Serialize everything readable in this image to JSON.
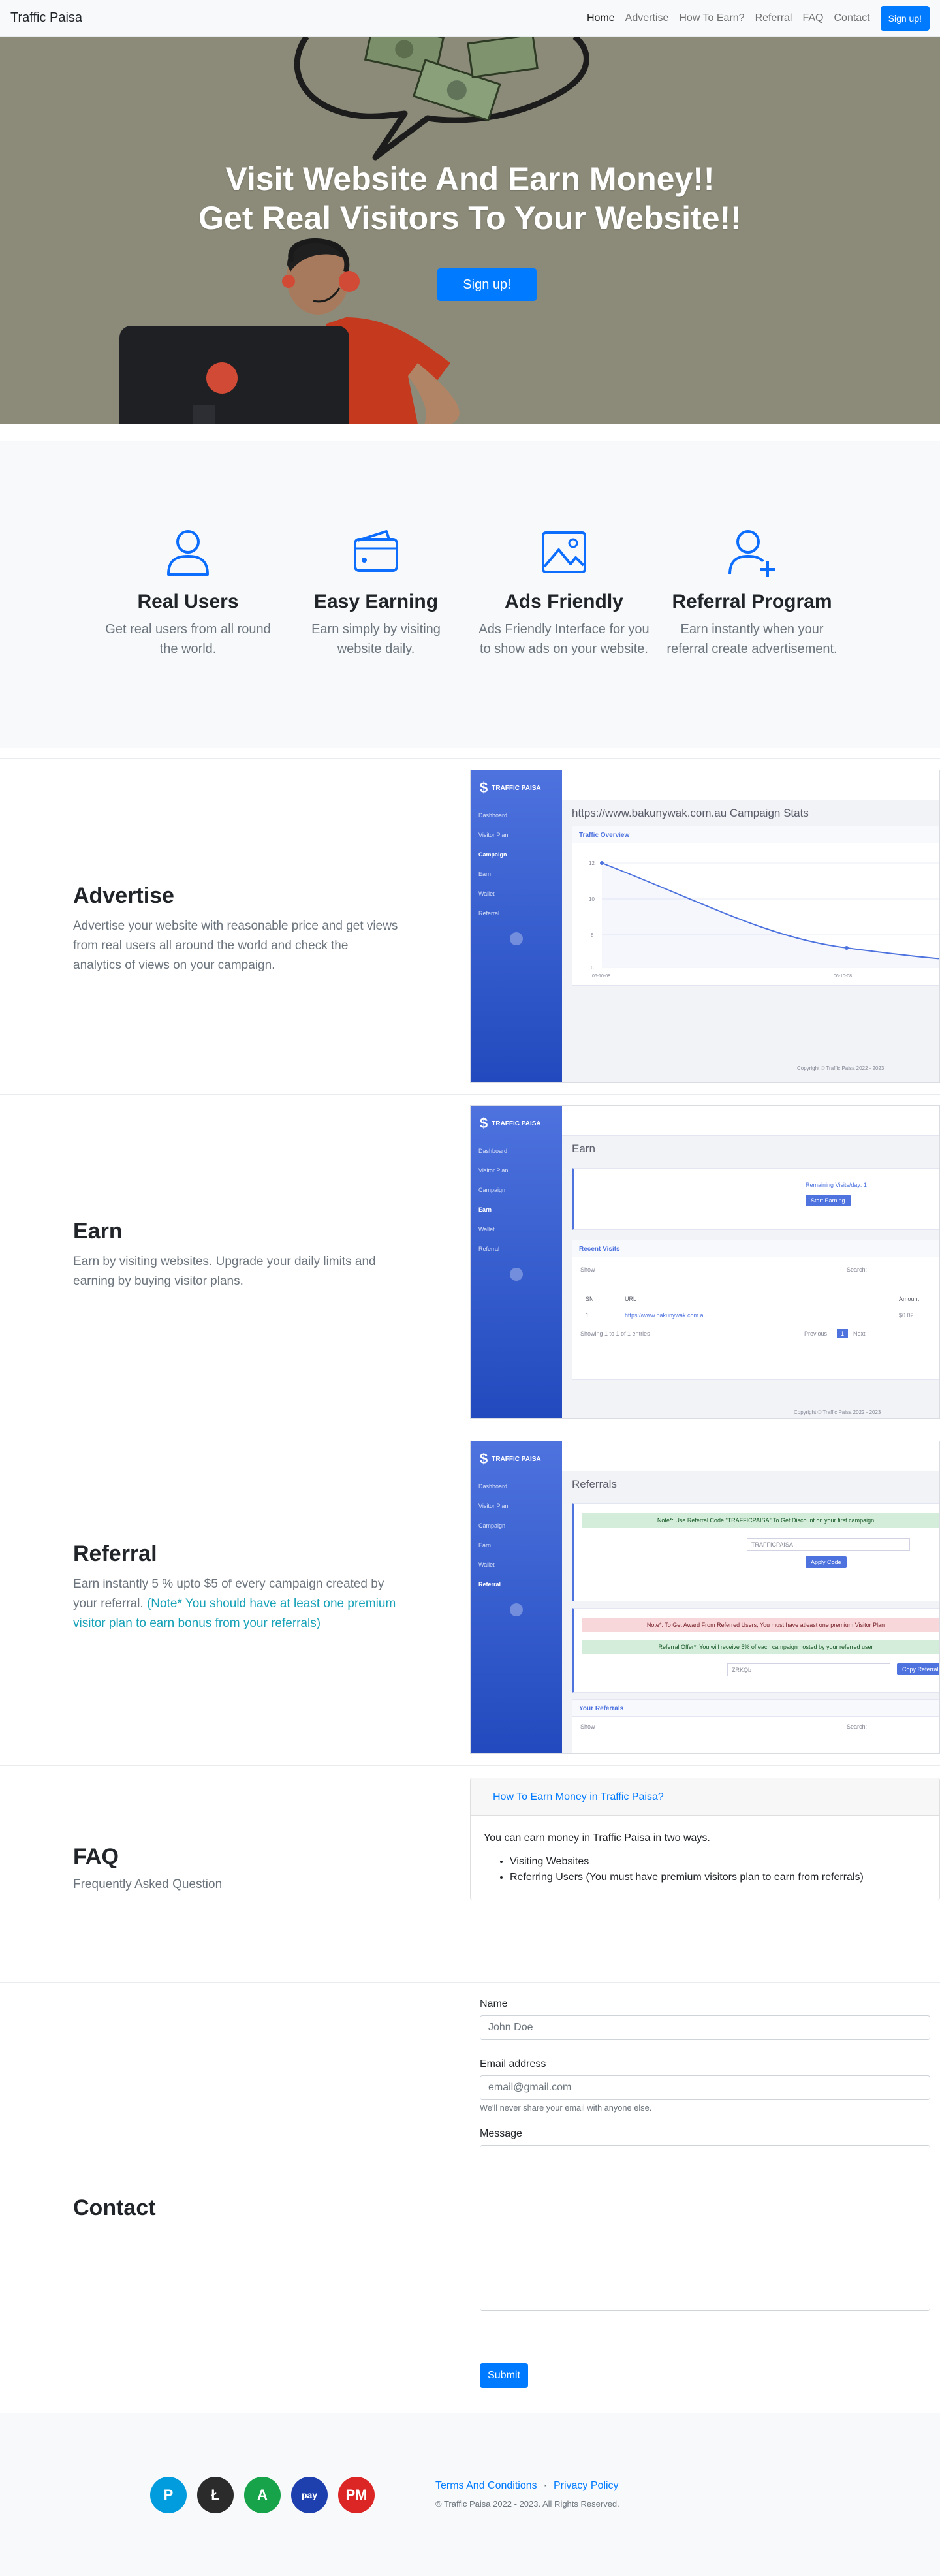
{
  "nav": {
    "brand": "Traffic Paisa",
    "links": [
      "Home",
      "Advertise",
      "How To Earn?",
      "Referral",
      "FAQ",
      "Contact"
    ],
    "signup": "Sign up!"
  },
  "hero": {
    "line1": "Visit Website And Earn Money!!",
    "line2": "Get Real Visitors To Your Website!!",
    "cta": "Sign up!"
  },
  "features": [
    {
      "icon": "user-icon",
      "title": "Real Users",
      "text": "Get real users from all round the world."
    },
    {
      "icon": "wallet-icon",
      "title": "Easy Earning",
      "text": "Earn simply by visiting website daily."
    },
    {
      "icon": "image-icon",
      "title": "Ads Friendly",
      "text": "Ads Friendly Interface for you to show ads on your website."
    },
    {
      "icon": "user-plus-icon",
      "title": "Referral Program",
      "text": "Earn instantly when your referral create advertisement."
    }
  ],
  "advertise": {
    "title": "Advertise",
    "text": "Advertise your website with reasonable price and get views from real users all around the world and check the analytics of views on your campaign.",
    "shot": {
      "logo": "TRAFFIC PAISA",
      "menu": [
        "Dashboard",
        "Visitor Plan",
        "Campaign",
        "Earn",
        "Wallet",
        "Referral"
      ],
      "heading": "https://www.bakunywak.com.au Campaign Stats",
      "card": "Traffic Overview",
      "yticks": [
        "12",
        "10",
        "8",
        "6"
      ],
      "xticks": [
        "06-10-08",
        "06-10-08"
      ],
      "footer": "Copyright © Traffic Paisa 2022 - 2023"
    }
  },
  "earn": {
    "title": "Earn",
    "text": "Earn by visiting websites. Upgrade your daily limits and earning by buying visitor plans.",
    "shot": {
      "heading": "Earn",
      "remaining": "Remaining Visits/day: 1",
      "start": "Start Earning",
      "recent": "Recent Visits",
      "show": "Show",
      "search": "Search:",
      "cols": [
        "SN",
        "URL",
        "Amount"
      ],
      "row": [
        "1",
        "https://www.bakunywak.com.au",
        "$0.02"
      ],
      "showing": "Showing 1 to 1 of 1 entries",
      "prev": "Previous",
      "page": "1",
      "next": "Next",
      "footer": "Copyright © Traffic Paisa 2022 - 2023"
    }
  },
  "referral": {
    "title": "Referral",
    "text": "Earn instantly 5 % upto $5 of every campaign created by your referral.",
    "note": "(Note* You should have at least one premium visitor plan to earn bonus from your referrals)",
    "shot": {
      "heading": "Referrals",
      "alert1": "Note*: Use Referral Code \"TRAFFICPAISA\" To Get Discount on your first campaign",
      "code": "TRAFFICPAISA",
      "apply": "Apply Code",
      "alert2": "Note*: To Get Award From Referred Users, You must have atleast one premium Visitor Plan",
      "alert3": "Referral Offer*: You will receive 5% of each campaign hosted by your referred user",
      "ref": "ZRKQb",
      "copy": "Copy Referral Link",
      "your": "Your Referrals",
      "show": "Show",
      "search": "Search:"
    }
  },
  "faq": {
    "title": "FAQ",
    "subtitle": "Frequently Asked Question",
    "question": "How To Earn Money in Traffic Paisa?",
    "answer": "You can earn money in Traffic Paisa in two ways.",
    "items": [
      "Visiting Websites",
      "Referring Users (You must have premium visitors plan to earn from referrals)"
    ]
  },
  "contact": {
    "title": "Contact",
    "name_label": "Name",
    "name_ph": "John Doe",
    "email_label": "Email address",
    "email_ph": "email@gmail.com",
    "email_help": "We'll never share your email with anyone else.",
    "msg_label": "Message",
    "submit": "Submit"
  },
  "footer": {
    "pay_labels": [
      "P",
      "Ł",
      "A",
      "pay",
      "PM"
    ],
    "pay_icons": [
      "paypal-icon",
      "litecoin-icon",
      "algorand-icon",
      "epay-icon",
      "perfect-money-icon"
    ],
    "pay_colors": [
      "#009cde",
      "#2b2b2b",
      "#16a34a",
      "#1e40af",
      "#dc2626"
    ],
    "terms": "Terms And Conditions",
    "privacy": "Privacy Policy",
    "copyright": "© Traffic Paisa 2022 - 2023. All Rights Reserved."
  }
}
